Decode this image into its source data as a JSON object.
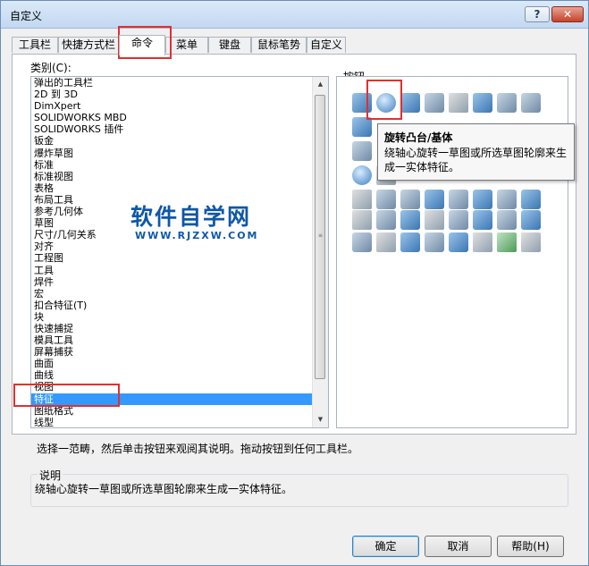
{
  "window": {
    "title": "自定义",
    "help_label": "?",
    "close_label": "✕"
  },
  "tabs": [
    {
      "label": "工具栏"
    },
    {
      "label": "快捷方式栏"
    },
    {
      "label": "命令"
    },
    {
      "label": "菜单"
    },
    {
      "label": "键盘"
    },
    {
      "label": "鼠标笔势"
    },
    {
      "label": "自定义"
    }
  ],
  "categories": {
    "label": "类别(C):",
    "items": [
      "弹出的工具栏",
      "2D 到 3D",
      "DimXpert",
      "SOLIDWORKS MBD",
      "SOLIDWORKS 插件",
      "钣金",
      "爆炸草图",
      "标准",
      "标准视图",
      "表格",
      "布局工具",
      "参考几何体",
      "草图",
      "尺寸/几何关系",
      "对齐",
      "工程图",
      "工具",
      "焊件",
      "宏",
      "扣合特征(T)",
      "块",
      "快速捕捉",
      "模具工具",
      "屏幕捕获",
      "曲面",
      "曲线",
      "视图",
      "特征",
      "图纸格式",
      "线型"
    ],
    "selected": "特征"
  },
  "buttons_panel": {
    "label": "按钮"
  },
  "tooltip": {
    "title": "旋转凸台/基体",
    "text": "绕轴心旋转一草图或所选草图轮廓来生成一实体特征。"
  },
  "hint": "选择一范畴，然后单击按钮来观阅其说明。拖动按钮到任何工具栏。",
  "description": {
    "legend": "说明",
    "text": "绕轴心旋转一草图或所选草图轮廓来生成一实体特征。"
  },
  "footer": {
    "ok": "确定",
    "cancel": "取消",
    "help": "帮助(H)"
  },
  "watermark": {
    "cn": "软件自学网",
    "en": "WWW.RJZXW.COM"
  },
  "colors": {
    "selection": "#3399ff",
    "highlight": "#e03030",
    "watermark": "#0e57a8"
  }
}
